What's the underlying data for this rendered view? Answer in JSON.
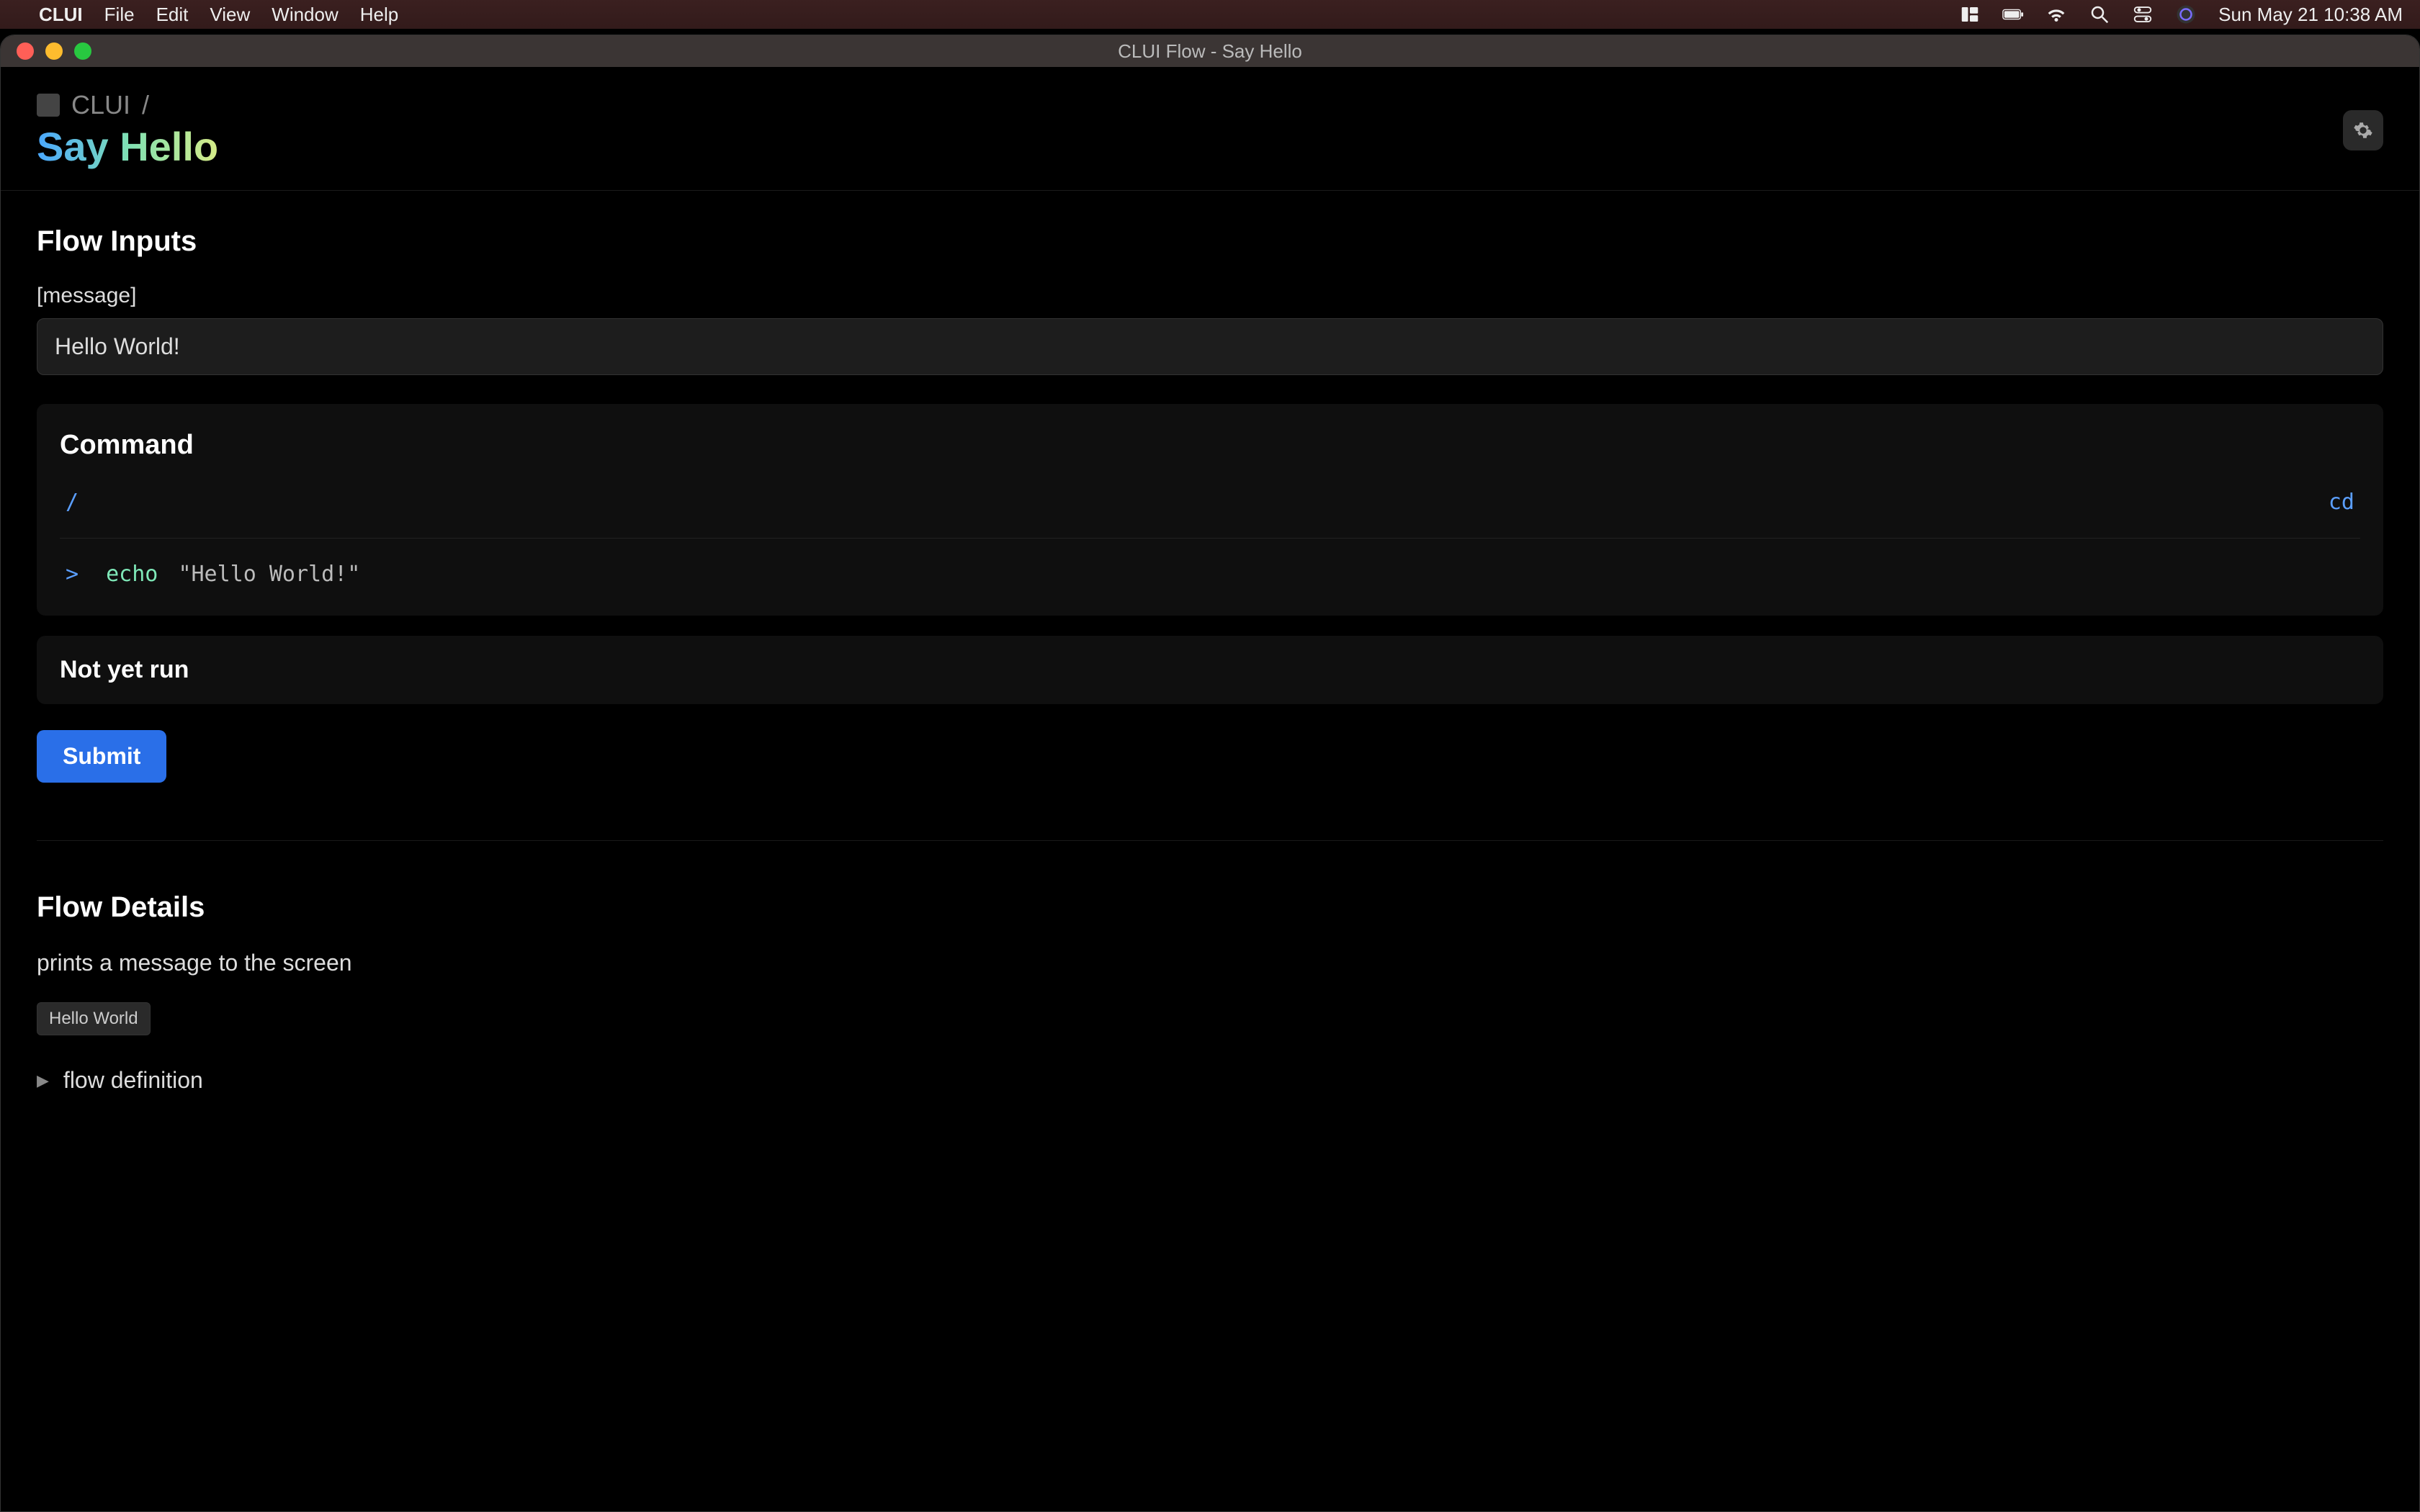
{
  "menubar": {
    "appname": "CLUI",
    "items": [
      "File",
      "Edit",
      "View",
      "Window",
      "Help"
    ],
    "datetime": "Sun May 21  10:38 AM"
  },
  "window": {
    "title": "CLUI Flow - Say Hello"
  },
  "header": {
    "breadcrumb_app": "CLUI",
    "breadcrumb_sep": "/",
    "page_title": "Say Hello"
  },
  "flow_inputs": {
    "section_title": "Flow Inputs",
    "field_label": "[message]",
    "field_value": "Hello World!"
  },
  "command": {
    "title": "Command",
    "path": "/",
    "cd_label": "cd",
    "prompt": ">",
    "exec": "echo",
    "arg": "\"Hello World!\""
  },
  "status": {
    "text": "Not yet run"
  },
  "submit": {
    "label": "Submit"
  },
  "flow_details": {
    "title": "Flow Details",
    "description": "prints a message to the screen",
    "tag": "Hello World",
    "disclosure_label": "flow definition"
  }
}
